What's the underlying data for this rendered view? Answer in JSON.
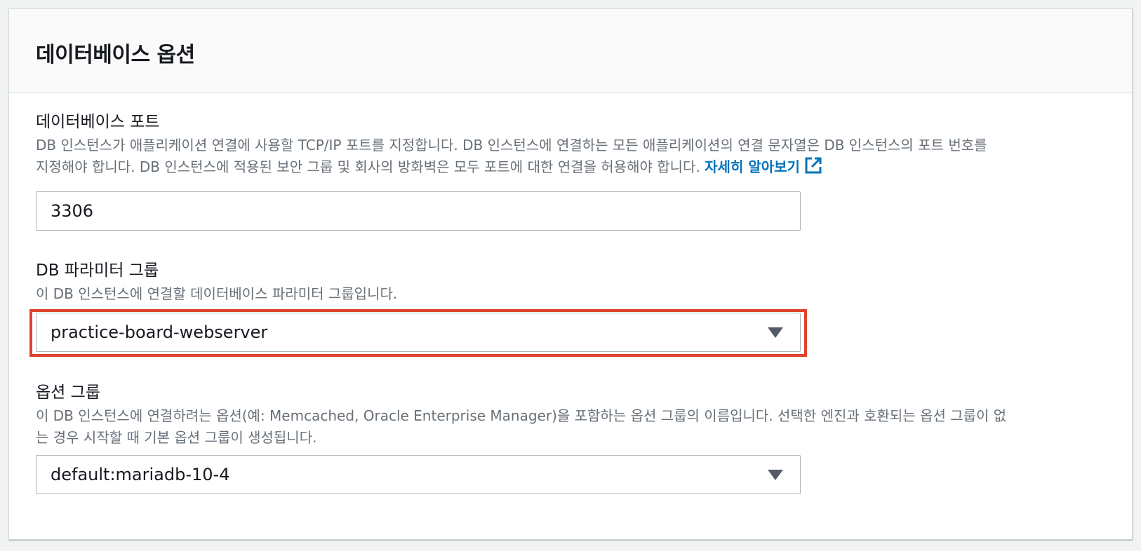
{
  "section": {
    "title": "데이터베이스 옵션"
  },
  "port": {
    "label": "데이터베이스 포트",
    "description_line1": "DB 인스턴스가 애플리케이션 연결에 사용할 TCP/IP 포트를 지정합니다. DB 인스턴스에 연결하는 모든 애플리케이션의 연결 문자열은 DB 인스턴스의 포트 번호를",
    "description_line2": "지정해야 합니다. DB 인스턴스에 적용된 보안 그룹 및 회사의 방화벽은 모두 포트에 대한 연결을 허용해야 합니다.",
    "learn_more": "자세히 알아보기",
    "value": "3306"
  },
  "parameter_group": {
    "label": "DB 파라미터 그룹",
    "description": "이 DB 인스턴스에 연결할 데이터베이스 파라미터 그룹입니다.",
    "selected": "practice-board-webserver"
  },
  "option_group": {
    "label": "옵션 그룹",
    "description_line1": "이 DB 인스턴스에 연결하려는 옵션(예: Memcached, Oracle Enterprise Manager)을 포함하는 옵션 그룹의 이름입니다. 선택한 엔진과 호환되는 옵션 그룹이 없",
    "description_line2": "는 경우 시작할 때 기본 옵션 그룹이 생성됩니다.",
    "selected": "default:mariadb-10-4"
  },
  "colors": {
    "link": "#0073bb",
    "highlight": "#e0432a",
    "header_bg": "#fafafa",
    "description_text": "#687078"
  },
  "icons": {
    "external_link": "external-link-icon",
    "dropdown": "caret-down-icon"
  }
}
